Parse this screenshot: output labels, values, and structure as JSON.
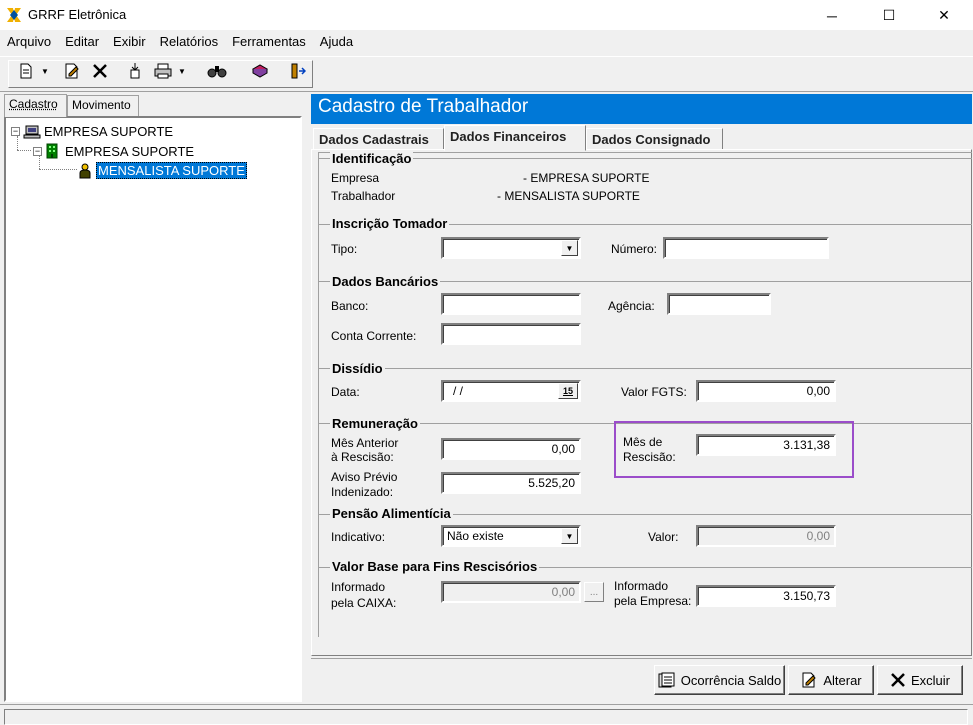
{
  "window": {
    "title": "GRRF Eletrônica",
    "controls": {
      "minimize": "─",
      "maximize": "☐",
      "close": "✕"
    }
  },
  "menu": [
    "Arquivo",
    "Editar",
    "Exibir",
    "Relatórios",
    "Ferramentas",
    "Ajuda"
  ],
  "toolbar": {
    "icons": [
      "new-document-icon",
      "edit-document-icon",
      "delete-icon",
      "import-icon",
      "print-icon",
      "find-icon",
      "book-icon",
      "exit-icon"
    ]
  },
  "left": {
    "tabs": [
      "Cadastro",
      "Movimento"
    ],
    "tree": {
      "root": "EMPRESA SUPORTE",
      "child": "EMPRESA SUPORTE",
      "leaf": "MENSALISTA SUPORTE"
    }
  },
  "panel": {
    "title": "Cadastro de Trabalhador",
    "tabs": [
      "Dados Cadastrais",
      "Dados Financeiros",
      "Dados Consignado"
    ]
  },
  "identificacao": {
    "title": "Identificação",
    "empresa_label": "Empresa",
    "empresa_value": "- EMPRESA SUPORTE",
    "trabalhador_label": "Trabalhador",
    "trabalhador_value": "- MENSALISTA SUPORTE"
  },
  "inscricao": {
    "title": "Inscrição Tomador",
    "tipo_label": "Tipo:",
    "tipo_value": "",
    "numero_label": "Número:",
    "numero_value": ""
  },
  "bancarios": {
    "title": "Dados Bancários",
    "banco_label": "Banco:",
    "banco_value": "",
    "agencia_label": "Agência:",
    "agencia_value": "",
    "conta_label": "Conta Corrente:",
    "conta_value": ""
  },
  "dissidio": {
    "title": "Dissídio",
    "data_label": "Data:",
    "data_value": "/ /",
    "calendar_label": "15",
    "fgts_label": "Valor FGTS:",
    "fgts_value": "0,00"
  },
  "remuneracao": {
    "title": "Remuneração",
    "mes_anterior_label_1": "Mês Anterior",
    "mes_anterior_label_2": "à Rescisão:",
    "mes_anterior_value": "0,00",
    "aviso_label_1": "Aviso Prévio",
    "aviso_label_2": "Indenizado:",
    "aviso_value": "5.525,20",
    "mes_rescisao_label_1": "Mês de",
    "mes_rescisao_label_2": "Rescisão:",
    "mes_rescisao_value": "3.131,38"
  },
  "pensao": {
    "title": "Pensão Alimentícia",
    "indicativo_label": "Indicativo:",
    "indicativo_value": "Não existe",
    "valor_label": "Valor:",
    "valor_value": "0,00"
  },
  "valor_base": {
    "title": "Valor Base para Fins Rescisórios",
    "caixa_label_1": "Informado",
    "caixa_label_2": "pela CAIXA:",
    "caixa_value": "0,00",
    "caixa_button": "...",
    "empresa_label_1": "Informado",
    "empresa_label_2": "pela Empresa:",
    "empresa_value": "3.150,73"
  },
  "buttons": {
    "ocorrencia": "Ocorrência Saldo",
    "alterar": "Alterar",
    "excluir": "Excluir"
  },
  "colors": {
    "accent": "#0078d7",
    "highlight": "#9b4dca"
  }
}
